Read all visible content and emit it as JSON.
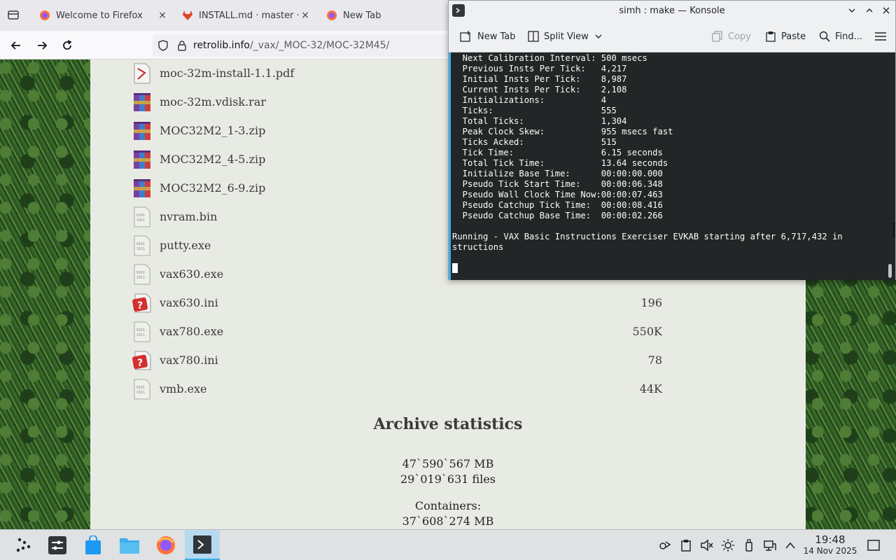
{
  "firefox": {
    "tabs": [
      {
        "title": "Welcome to Firefox",
        "close": "×"
      },
      {
        "title": "INSTALL.md · master · v",
        "close": "×"
      },
      {
        "title": "New Tab"
      }
    ],
    "url": {
      "host": "retrolib.info",
      "path": "/_vax/_MOC-32/MOC-32M45/"
    }
  },
  "page": {
    "files": [
      {
        "name": "moc-32m-install-1.1.pdf",
        "size": "",
        "icon": "pdf-file-icon"
      },
      {
        "name": "moc-32m.vdisk.rar",
        "size": "",
        "icon": "archive-file-icon"
      },
      {
        "name": "MOC32M2_1-3.zip",
        "size": "",
        "icon": "archive-file-icon"
      },
      {
        "name": "MOC32M2_4-5.zip",
        "size": "",
        "icon": "archive-file-icon"
      },
      {
        "name": "MOC32M2_6-9.zip",
        "size": "",
        "icon": "archive-file-icon"
      },
      {
        "name": "nvram.bin",
        "size": "",
        "icon": "binary-file-icon"
      },
      {
        "name": "putty.exe",
        "size": "",
        "icon": "binary-file-icon"
      },
      {
        "name": "vax630.exe",
        "size": "",
        "icon": "binary-file-icon"
      },
      {
        "name": "vax630.ini",
        "size": "196",
        "icon": "unknown-file-icon"
      },
      {
        "name": "vax780.exe",
        "size": "550K",
        "icon": "binary-file-icon"
      },
      {
        "name": "vax780.ini",
        "size": "78",
        "icon": "unknown-file-icon"
      },
      {
        "name": "vmb.exe",
        "size": "44K",
        "icon": "binary-file-icon"
      }
    ],
    "archive_title": "Archive statistics",
    "stats": {
      "size": "47`590`567 MB",
      "files": "29`019`631 files",
      "containers_label": "Containers:",
      "containers_size": "37`608`274 MB"
    }
  },
  "konsole": {
    "title": "simh : make — Konsole",
    "toolbar": {
      "new_tab": "New Tab",
      "split_view": "Split View",
      "copy": "Copy",
      "paste": "Paste",
      "find": "Find..."
    },
    "lines": [
      "  Next Calibration Interval: 500 msecs",
      "  Previous Insts Per Tick:   4,217",
      "  Initial Insts Per Tick:    8,987",
      "  Current Insts Per Tick:    2,108",
      "  Initializations:           4",
      "  Ticks:                     555",
      "  Total Ticks:               1,304",
      "  Peak Clock Skew:           955 msecs fast",
      "  Ticks Acked:               515",
      "  Tick Time:                 6.15 seconds",
      "  Total Tick Time:           13.64 seconds",
      "  Initialize Base Time:      00:00:00.000",
      "  Pseudo Tick Start Time:    00:00:06.348",
      "  Pseudo Wall Clock Time Now:00:00:07.463",
      "  Pseudo Catchup Tick Time:  00:00:08.416",
      "  Pseudo Catchup Base Time:  00:00:02.266",
      "",
      "Running - VAX Basic Instructions Exerciser EVKAB starting after 6,717,432 in",
      "structions"
    ]
  },
  "taskbar": {
    "clock_time": "19:48",
    "clock_date": "14 Nov 2025"
  },
  "colors": {
    "accent": "#3daee9",
    "terminal_bg": "#232627",
    "page_bg": "#e8ebe3"
  }
}
